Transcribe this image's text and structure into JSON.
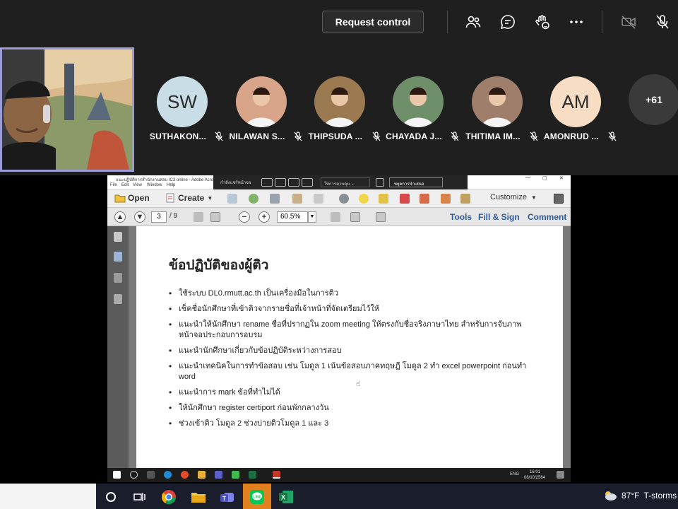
{
  "meeting": {
    "request_control_label": "Request control"
  },
  "participants": [
    {
      "initials": "SW",
      "name": "SUTHAKON...",
      "avatar_color": "#c9dde6",
      "photo": false
    },
    {
      "initials": "",
      "name": "NILAWAN S...",
      "avatar_color": "#d8a58a",
      "photo": true
    },
    {
      "initials": "",
      "name": "THIPSUDA ...",
      "avatar_color": "#9b7a52",
      "photo": true
    },
    {
      "initials": "",
      "name": "CHAYADA J...",
      "avatar_color": "#6f8f6a",
      "photo": true
    },
    {
      "initials": "",
      "name": "THITIMA IM...",
      "avatar_color": "#9f7f6c",
      "photo": true
    },
    {
      "initials": "AM",
      "name": "AMONRUD ...",
      "avatar_color": "#f6ddc4",
      "photo": false
    }
  ],
  "more_participants": "+61",
  "acrobat": {
    "menu": [
      "File",
      "Edit",
      "View",
      "Window",
      "Help"
    ],
    "open_label": "Open",
    "create_label": "Create",
    "customize_label": "Customize",
    "page_current": "3",
    "page_total": "/ 9",
    "zoom": "60.5%",
    "tools_label": "Tools",
    "fill_sign_label": "Fill & Sign",
    "comment_label": "Comment"
  },
  "slide": {
    "title": "ข้อปฏิบัติของผู้ติว",
    "bullets": [
      "ใช้ระบบ DL0.rmutt.ac.th เป็นเครื่องมือในการติว",
      "เช็คชื่อนักศึกษาที่เข้าติวจากรายชื่อที่เจ้าหน้าที่จัดเตรียมไว้ให้",
      "แนะนำให้นักศึกษา rename ชื่อที่ปรากฏใน zoom meeting ให้ตรงกับชื่อจริงภาษาไทย สำหรับการจับภาพหน้าจอประกอบการอบรม",
      "แนะนำนักศึกษาเกี่ยวกับข้อปฏิบัติระหว่างการสอบ",
      "แนะนำเทคนิคในการทำข้อสอบ เช่น โมดูล 1 เน้นข้อสอบภาคทฤษฎี โมดูล 2 ทำ excel powerpoint ก่อนทำ word",
      "แนะนำการ mark ข้อที่ทำไม่ได้",
      "ให้นักศึกษา register certiport ก่อนพักกลางวัน",
      "ช่วงเข้าติว โมดูล 2 ช่วงบ่ายติวโมดูล 1 และ 3"
    ]
  },
  "inner_tray": {
    "lang": "ENG",
    "time": "16:01",
    "date": "08/10/2564"
  },
  "weather": {
    "temp": "87°F",
    "condition": "T-storms"
  }
}
